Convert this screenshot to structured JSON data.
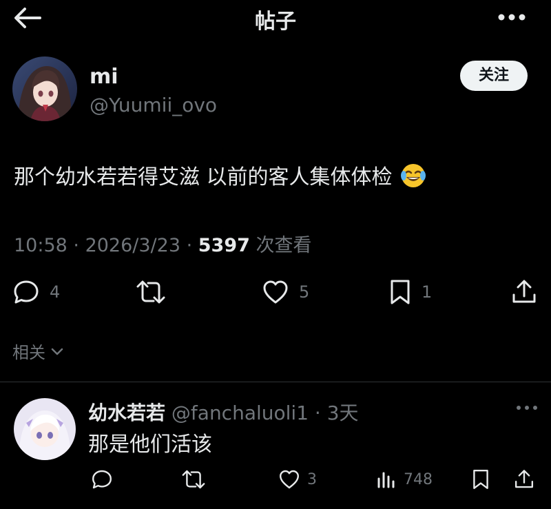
{
  "header": {
    "title": "帖子",
    "back_icon": "arrow-left-icon",
    "more_icon": "more-horizontal-icon"
  },
  "post": {
    "author": {
      "display_name": "mi",
      "handle": "@Yuumii_ovo",
      "avatar_icon": "anime-girl-avatar"
    },
    "follow_label": "关注",
    "text": "那个幼水若若得艾滋 以前的客人集体体检",
    "emoji": "face-with-tears-of-joy",
    "meta": {
      "time": "10:58",
      "sep1": " · ",
      "date": "2026/3/23",
      "sep2": " · ",
      "views": "5397",
      "views_label": "次查看"
    },
    "actions": {
      "replies": "4",
      "likes": "5",
      "bookmarks": "1"
    }
  },
  "related": {
    "label": "相关"
  },
  "reply": {
    "display_name": "幼水若若",
    "handle": "@fanchaluoli1",
    "sep": " · ",
    "age": "3天",
    "text": "那是他们活该",
    "actions": {
      "likes": "3",
      "views": "748"
    }
  },
  "colors": {
    "background": "#000000",
    "text": "#e7e9ea",
    "muted": "#71767b",
    "divider": "#2f3336",
    "follow_bg": "#eff3f4"
  }
}
